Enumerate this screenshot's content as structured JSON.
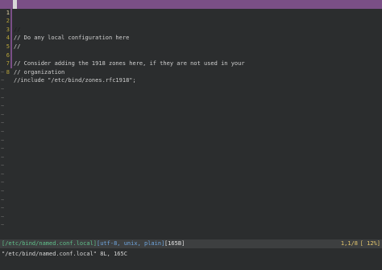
{
  "editor": {
    "lines": [
      {
        "num": "1",
        "text": "//"
      },
      {
        "num": "2",
        "text": "// Do any local configuration here"
      },
      {
        "num": "3",
        "text": "//"
      },
      {
        "num": "4",
        "text": ""
      },
      {
        "num": "5",
        "text": "// Consider adding the 1918 zones here, if they are not used in your"
      },
      {
        "num": "6",
        "text": "// organization"
      },
      {
        "num": "7",
        "text": "//include \"/etc/bind/zones.rfc1918\";"
      },
      {
        "num": "8",
        "text": ""
      }
    ],
    "tilde": "~"
  },
  "statusbar": {
    "path": "[/etc/bind/named.conf.local]",
    "encoding": "[utf-8, unix, plain]",
    "size": "[165B]",
    "position": "1,1/8",
    "percent": "[ 12%]"
  },
  "cmdline": {
    "message": "\"/etc/bind/named.conf.local\" 8L, 165C"
  },
  "colors": {
    "background": "#2b2d2e",
    "current_line": "#7a4f86",
    "line_number": "#b8a43a",
    "status_path": "#5fbf8a",
    "status_encoding": "#6fa6df",
    "status_position": "#e6c86e"
  }
}
